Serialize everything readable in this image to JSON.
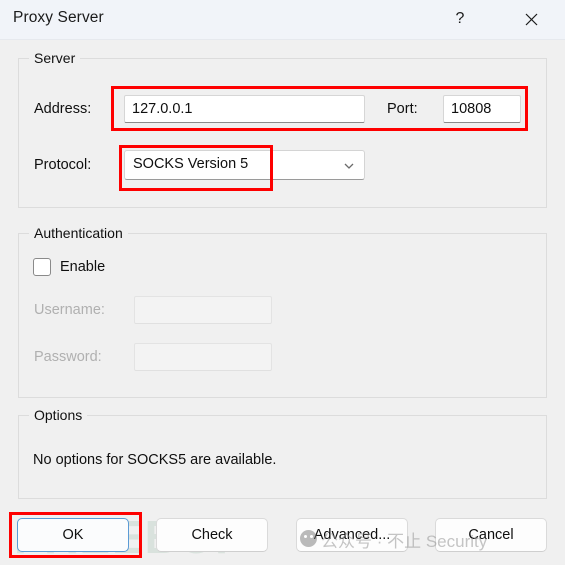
{
  "window": {
    "title": "Proxy Server",
    "help_icon": "question-mark-icon",
    "close_icon": "close-icon"
  },
  "server_group": {
    "title": "Server",
    "address_label": "Address:",
    "address_value": "127.0.0.1",
    "address_placeholder": "",
    "port_label": "Port:",
    "port_value": "10808",
    "port_placeholder": "",
    "protocol_label": "Protocol:",
    "protocol_value": "SOCKS Version 5",
    "protocol_options": [
      "SOCKS Version 5"
    ],
    "protocol_chevron_icon": "chevron-down-icon"
  },
  "auth_group": {
    "title": "Authentication",
    "enable_label": "Enable",
    "enable_checked": false,
    "username_label": "Username:",
    "username_value": "",
    "username_placeholder": "",
    "password_label": "Password:",
    "password_value": "",
    "password_placeholder": ""
  },
  "options_group": {
    "title": "Options",
    "message": "No options for SOCKS5 are available."
  },
  "buttons": {
    "ok": "OK",
    "check": "Check",
    "advanced": "Advanced...",
    "cancel": "Cancel"
  },
  "watermarks": {
    "brand": "FREEBUF",
    "chinese": "公众号 · 不止 Security",
    "wechat_icon": "wechat-icon"
  },
  "colors": {
    "annotation_red": "#fe0000",
    "focus_blue": "#5b9bd5",
    "window_background": "#f0f0f0",
    "titlebar_background": "#f1f4f9"
  }
}
